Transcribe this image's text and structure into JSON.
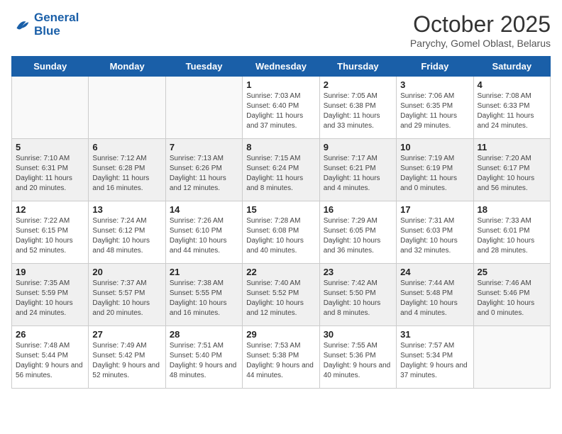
{
  "header": {
    "logo_line1": "General",
    "logo_line2": "Blue",
    "month": "October 2025",
    "location": "Parychy, Gomel Oblast, Belarus"
  },
  "weekdays": [
    "Sunday",
    "Monday",
    "Tuesday",
    "Wednesday",
    "Thursday",
    "Friday",
    "Saturday"
  ],
  "weeks": [
    [
      {
        "day": "",
        "info": ""
      },
      {
        "day": "",
        "info": ""
      },
      {
        "day": "",
        "info": ""
      },
      {
        "day": "1",
        "info": "Sunrise: 7:03 AM\nSunset: 6:40 PM\nDaylight: 11 hours and 37 minutes."
      },
      {
        "day": "2",
        "info": "Sunrise: 7:05 AM\nSunset: 6:38 PM\nDaylight: 11 hours and 33 minutes."
      },
      {
        "day": "3",
        "info": "Sunrise: 7:06 AM\nSunset: 6:35 PM\nDaylight: 11 hours and 29 minutes."
      },
      {
        "day": "4",
        "info": "Sunrise: 7:08 AM\nSunset: 6:33 PM\nDaylight: 11 hours and 24 minutes."
      }
    ],
    [
      {
        "day": "5",
        "info": "Sunrise: 7:10 AM\nSunset: 6:31 PM\nDaylight: 11 hours and 20 minutes."
      },
      {
        "day": "6",
        "info": "Sunrise: 7:12 AM\nSunset: 6:28 PM\nDaylight: 11 hours and 16 minutes."
      },
      {
        "day": "7",
        "info": "Sunrise: 7:13 AM\nSunset: 6:26 PM\nDaylight: 11 hours and 12 minutes."
      },
      {
        "day": "8",
        "info": "Sunrise: 7:15 AM\nSunset: 6:24 PM\nDaylight: 11 hours and 8 minutes."
      },
      {
        "day": "9",
        "info": "Sunrise: 7:17 AM\nSunset: 6:21 PM\nDaylight: 11 hours and 4 minutes."
      },
      {
        "day": "10",
        "info": "Sunrise: 7:19 AM\nSunset: 6:19 PM\nDaylight: 11 hours and 0 minutes."
      },
      {
        "day": "11",
        "info": "Sunrise: 7:20 AM\nSunset: 6:17 PM\nDaylight: 10 hours and 56 minutes."
      }
    ],
    [
      {
        "day": "12",
        "info": "Sunrise: 7:22 AM\nSunset: 6:15 PM\nDaylight: 10 hours and 52 minutes."
      },
      {
        "day": "13",
        "info": "Sunrise: 7:24 AM\nSunset: 6:12 PM\nDaylight: 10 hours and 48 minutes."
      },
      {
        "day": "14",
        "info": "Sunrise: 7:26 AM\nSunset: 6:10 PM\nDaylight: 10 hours and 44 minutes."
      },
      {
        "day": "15",
        "info": "Sunrise: 7:28 AM\nSunset: 6:08 PM\nDaylight: 10 hours and 40 minutes."
      },
      {
        "day": "16",
        "info": "Sunrise: 7:29 AM\nSunset: 6:05 PM\nDaylight: 10 hours and 36 minutes."
      },
      {
        "day": "17",
        "info": "Sunrise: 7:31 AM\nSunset: 6:03 PM\nDaylight: 10 hours and 32 minutes."
      },
      {
        "day": "18",
        "info": "Sunrise: 7:33 AM\nSunset: 6:01 PM\nDaylight: 10 hours and 28 minutes."
      }
    ],
    [
      {
        "day": "19",
        "info": "Sunrise: 7:35 AM\nSunset: 5:59 PM\nDaylight: 10 hours and 24 minutes."
      },
      {
        "day": "20",
        "info": "Sunrise: 7:37 AM\nSunset: 5:57 PM\nDaylight: 10 hours and 20 minutes."
      },
      {
        "day": "21",
        "info": "Sunrise: 7:38 AM\nSunset: 5:55 PM\nDaylight: 10 hours and 16 minutes."
      },
      {
        "day": "22",
        "info": "Sunrise: 7:40 AM\nSunset: 5:52 PM\nDaylight: 10 hours and 12 minutes."
      },
      {
        "day": "23",
        "info": "Sunrise: 7:42 AM\nSunset: 5:50 PM\nDaylight: 10 hours and 8 minutes."
      },
      {
        "day": "24",
        "info": "Sunrise: 7:44 AM\nSunset: 5:48 PM\nDaylight: 10 hours and 4 minutes."
      },
      {
        "day": "25",
        "info": "Sunrise: 7:46 AM\nSunset: 5:46 PM\nDaylight: 10 hours and 0 minutes."
      }
    ],
    [
      {
        "day": "26",
        "info": "Sunrise: 7:48 AM\nSunset: 5:44 PM\nDaylight: 9 hours and 56 minutes."
      },
      {
        "day": "27",
        "info": "Sunrise: 7:49 AM\nSunset: 5:42 PM\nDaylight: 9 hours and 52 minutes."
      },
      {
        "day": "28",
        "info": "Sunrise: 7:51 AM\nSunset: 5:40 PM\nDaylight: 9 hours and 48 minutes."
      },
      {
        "day": "29",
        "info": "Sunrise: 7:53 AM\nSunset: 5:38 PM\nDaylight: 9 hours and 44 minutes."
      },
      {
        "day": "30",
        "info": "Sunrise: 7:55 AM\nSunset: 5:36 PM\nDaylight: 9 hours and 40 minutes."
      },
      {
        "day": "31",
        "info": "Sunrise: 7:57 AM\nSunset: 5:34 PM\nDaylight: 9 hours and 37 minutes."
      },
      {
        "day": "",
        "info": ""
      }
    ]
  ]
}
